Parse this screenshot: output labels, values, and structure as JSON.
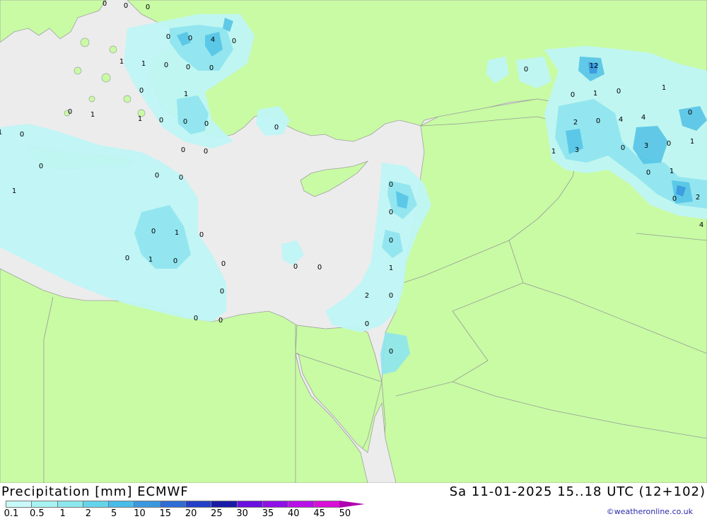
{
  "header": {
    "title_left": "Precipitation [mm] ECMWF",
    "title_right": "Sa 11-01-2025 15..18 UTC (12+102)"
  },
  "legend": {
    "ticks": [
      "0.1",
      "0.5",
      "1",
      "2",
      "5",
      "10",
      "15",
      "20",
      "25",
      "30",
      "35",
      "40",
      "45",
      "50"
    ],
    "colors": [
      "#c8fafa",
      "#a8f2f2",
      "#8ce8ee",
      "#64d4ea",
      "#48bcea",
      "#3a98e0",
      "#2e6cd6",
      "#2440c8",
      "#1a1aa8",
      "#6a10e0",
      "#9010e8",
      "#b810e8",
      "#d810d8",
      "#b000b0"
    ]
  },
  "credit": "©weatheronline.co.uk",
  "colors": {
    "land": "#c8fba4",
    "sea": "#ececec",
    "border": "#999999",
    "precip_light": "#c0f6f6",
    "precip_med": "#8ee4ee",
    "precip_heavy": "#56c4e6",
    "precip_peak": "#3a98e0"
  },
  "map_values": [
    "0",
    "0",
    "0",
    "0",
    "0",
    "4",
    "0",
    "1",
    "1",
    "0",
    "0",
    "0",
    "1",
    "0",
    "0",
    "1",
    "1",
    "0",
    "0",
    "0",
    "1",
    "0",
    "0",
    "0",
    "0",
    "0",
    "0",
    "1",
    "0",
    "1",
    "0",
    "0",
    "1",
    "0",
    "0",
    "0",
    "0",
    "0",
    "0",
    "0",
    "0",
    "0",
    "0",
    "0",
    "1",
    "2",
    "0",
    "0",
    "0",
    "0",
    "0",
    "1",
    "12",
    "0",
    "1",
    "2",
    "0",
    "4",
    "4",
    "0",
    "1",
    "3",
    "0",
    "3",
    "0",
    "1",
    "0",
    "1",
    "0",
    "2",
    "4",
    "5",
    "0"
  ]
}
